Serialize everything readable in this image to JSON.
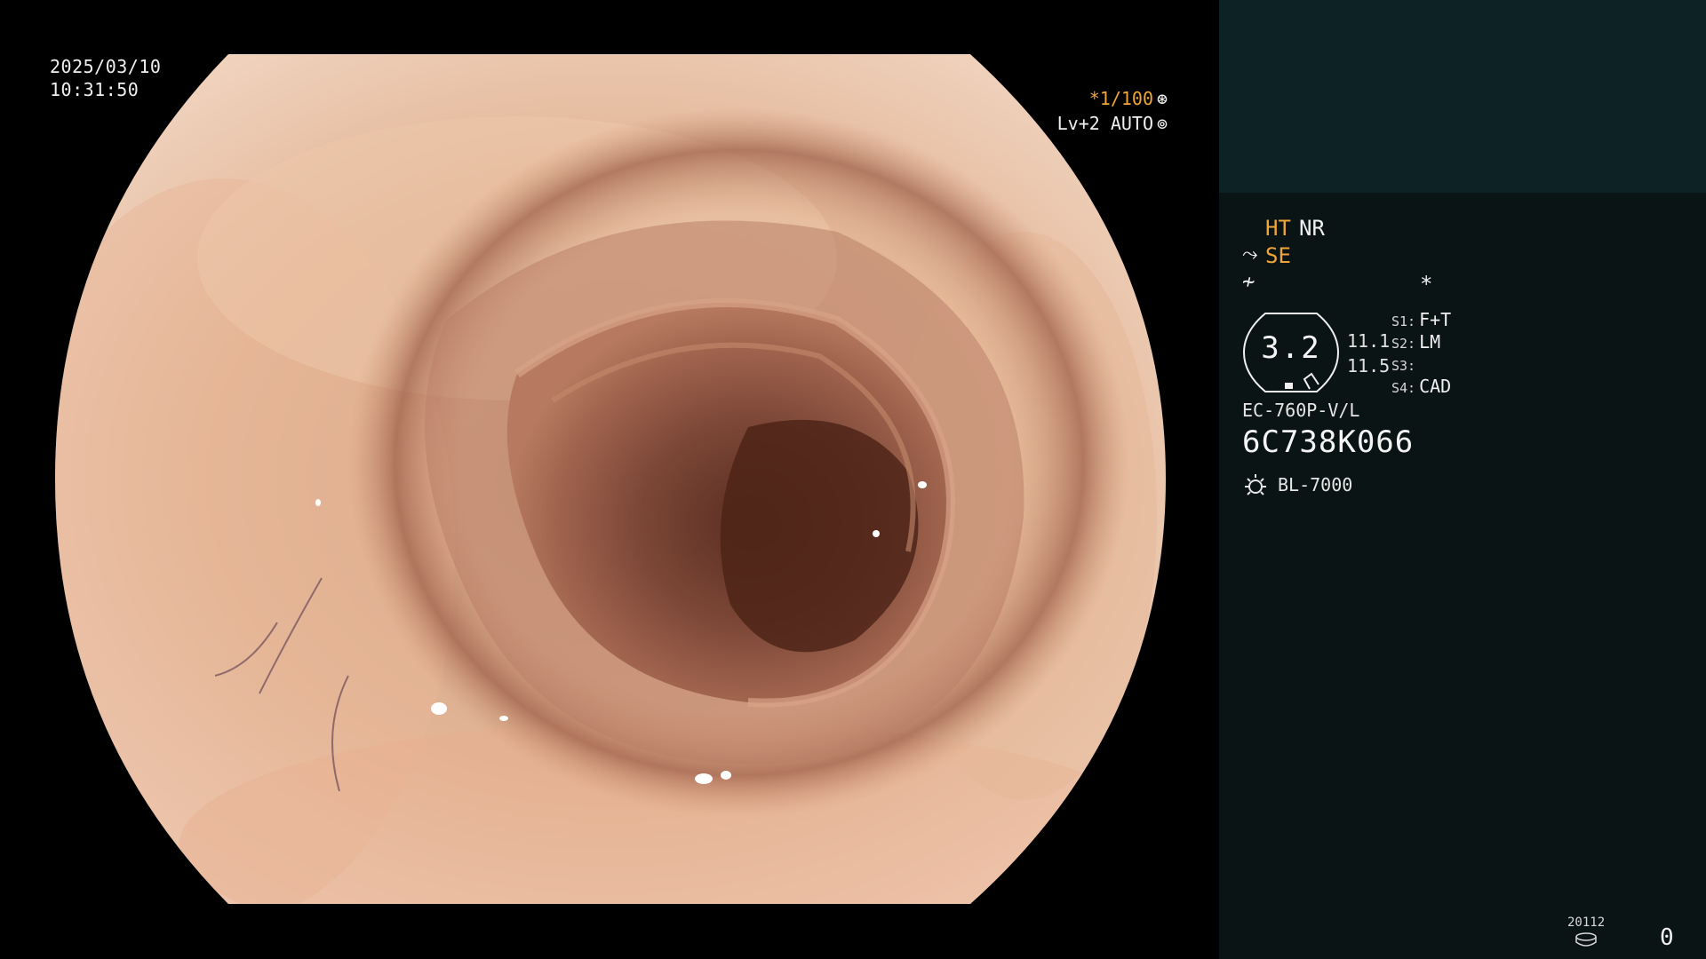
{
  "overlay": {
    "date": "2025/03/10",
    "time": "10:31:50",
    "shutter": "*1/100",
    "iris": "Lv+2 AUTO"
  },
  "panel": {
    "ht": "HT",
    "nr": "NR",
    "se": "SE",
    "star": "*",
    "scale_value": "3.2",
    "value1": "11.1",
    "value2": "11.5",
    "s1_key": "S1:",
    "s1_val": "F+T",
    "s2_key": "S2:",
    "s2_val": "LM",
    "s3_key": "S3:",
    "s3_val": "",
    "s4_key": "S4:",
    "s4_val": "CAD",
    "scope_model": "EC-760P-V/L",
    "scope_serial": "6C738K066",
    "light_source": "BL-7000",
    "counter_small": "20112",
    "counter": "0"
  },
  "colors": {
    "accent_orange": "#f0a53a",
    "panel_bg": "#0a1414",
    "panel_top_bg": "#0d2224"
  },
  "icons": {
    "shutter": "asterisk-circle-icon",
    "iris": "iris-circle-icon",
    "se": "enhance-curve-icon",
    "f": "f-curve-icon",
    "menu": "menu-list-icon",
    "light": "sun-icon",
    "disk": "disk-icon"
  }
}
